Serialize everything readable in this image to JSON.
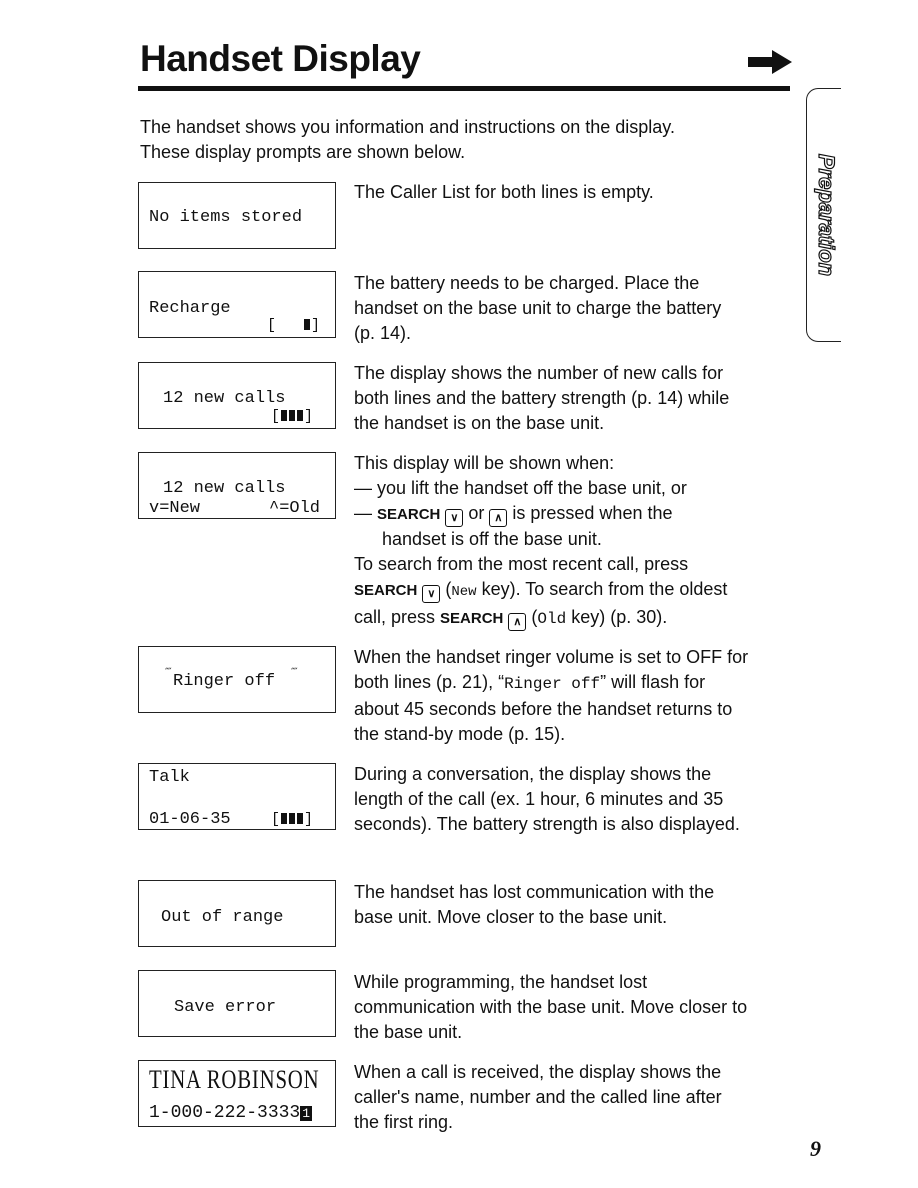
{
  "title": "Handset Display",
  "side_tab": "Preparation",
  "page_number": "9",
  "intro": [
    "The handset shows you information and instructions on the display.",
    "These display prompts are shown below."
  ],
  "displays": [
    {
      "lines": [
        "No items stored"
      ],
      "desc": [
        "The Caller List for both lines is empty."
      ]
    },
    {
      "lines": [
        "Recharge"
      ],
      "desc": [
        "The battery needs to be charged. Place the",
        "handset on the base unit to charge the battery",
        "(p. 14)."
      ]
    },
    {
      "lines": [
        "12 new calls"
      ],
      "desc": [
        "The display shows the number of new calls for",
        "both lines and the battery strength (p. 14) while",
        "the handset is on the base unit."
      ]
    },
    {
      "lines": [
        "12 new calls",
        "v=New",
        "^=Old"
      ],
      "desc": [
        "This display will be shown when:",
        "— you lift the handset off the base unit, or",
        "— ",
        "SEARCH",
        " or ",
        " is pressed when the",
        "handset is off the base unit.",
        "To search from the most recent call, press",
        "SEARCH",
        " (",
        "New",
        " key). To search from the oldest",
        "call, press ",
        "SEARCH",
        " (",
        "Old",
        " key) (p. 30)."
      ]
    },
    {
      "lines": [
        "Ringer off"
      ],
      "desc": [
        "When the handset ringer volume is set to OFF for",
        "both lines (p. 21), “",
        "Ringer off",
        "” will flash for",
        "about 45 seconds before the handset returns to",
        "the stand-by mode (p. 15)."
      ]
    },
    {
      "lines": [
        "Talk",
        "01-06-35"
      ],
      "desc": [
        "During a conversation, the display shows the",
        "length of the call (ex. 1 hour, 6 minutes and 35",
        "seconds). The battery strength is also displayed."
      ]
    },
    {
      "lines": [
        "Out of range"
      ],
      "desc": [
        "The handset has lost communication with the",
        "base unit. Move closer to the base unit."
      ]
    },
    {
      "lines": [
        "Save error"
      ],
      "desc": [
        "While programming, the handset lost",
        "communication with the base unit. Move closer to",
        "the base unit."
      ]
    },
    {
      "lines": [
        "TINA ROBINSON",
        "1-000-222-3333",
        "1"
      ],
      "desc": [
        "When a call is received, the display shows the",
        "caller's name, number and the called line after",
        "the first ring."
      ]
    }
  ]
}
